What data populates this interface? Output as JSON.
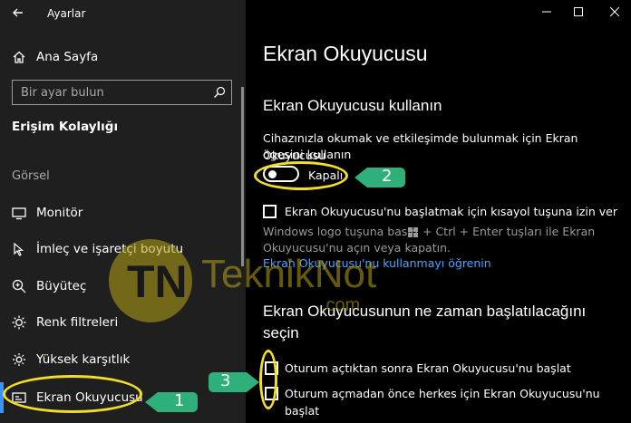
{
  "window": {
    "title": "Ayarlar"
  },
  "sidebar": {
    "home_label": "Ana Sayfa",
    "search_placeholder": "Bir ayar bulun",
    "section_title": "Erişim Kolaylığı",
    "group_label": "Görsel",
    "items": [
      {
        "label": "Monitör",
        "icon": "monitor-icon"
      },
      {
        "label": "İmleç ve işaretçi boyutu",
        "icon": "pointer-icon"
      },
      {
        "label": "Büyüteç",
        "icon": "magnifier-icon"
      },
      {
        "label": "Renk filtreleri",
        "icon": "sun-icon"
      },
      {
        "label": "Yüksek karşıtlık",
        "icon": "contrast-icon"
      },
      {
        "label": "Ekran Okuyucusu",
        "icon": "narrator-icon",
        "selected": true
      }
    ]
  },
  "main": {
    "page_title": "Ekran Okuyucusu",
    "use_heading": "Ekran Okuyucusu kullanın",
    "description_line1": "Cihazınızla okumak ve etkileşimde bulunmak için Ekran Okuyucusu",
    "description_line2": "ögesini kullanın",
    "toggle_state": "Kapalı",
    "shortcut_checkbox_label": "Ekran Okuyucusu'nu başlatmak için kısayol tuşuna izin ver",
    "shortcut_help_line1a": "Windows logo tuşuna basın",
    "shortcut_help_line1b": "+ Ctrl + Enter tuşları ile Ekran",
    "shortcut_help_line2": "Okuyucusu'nu açın veya kapatın.",
    "learn_link": "Ekran Okuyucusu'nu kullanmayı öğrenin",
    "start_heading_line1": "Ekran Okuyucusunun ne zaman başlatılacağını",
    "start_heading_line2": "seçin",
    "start_option1": "Oturum açtıktan sonra Ekran Okuyucusu'nu başlat",
    "start_option2": "Oturum açmadan önce herkes için Ekran Okuyucusu'nu başlat"
  },
  "annotations": {
    "step1": "1",
    "step2": "2",
    "step3": "3",
    "highlight_color": "#f2dd2a",
    "callout_color": "#2fb07a"
  },
  "watermark": {
    "logo_letters": "TN",
    "brand": "TeknikNot",
    "suffix": ".com"
  }
}
